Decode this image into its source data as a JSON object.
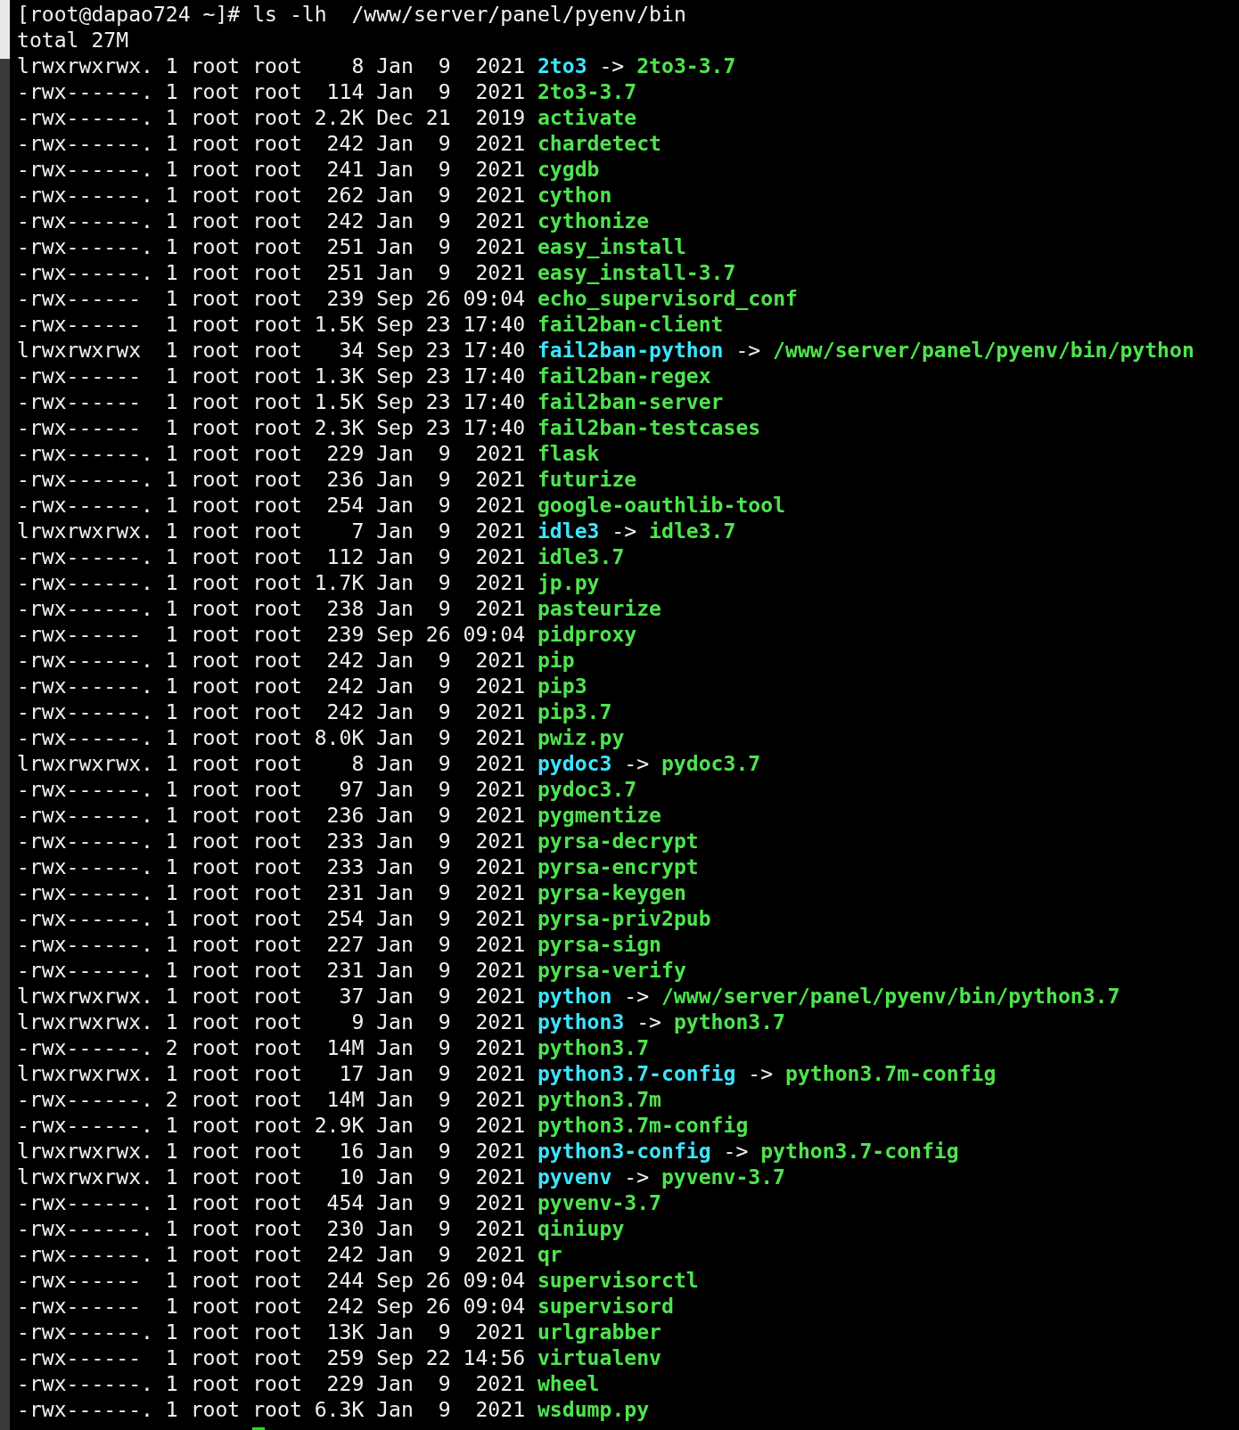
{
  "terminal": {
    "command_line": "[root@dapao724 ~]# ls -lh  /www/server/panel/pyenv/bin",
    "total": "total 27M",
    "cursor": true,
    "rows": [
      {
        "perms": "lrwxrwxrwx.",
        "links": "1",
        "owner": "root",
        "group": "root",
        "size": "8",
        "month": "Jan",
        "day": "9",
        "time": "2021",
        "name": "2to3",
        "kind": "link",
        "arrow": "->",
        "target": "2to3-3.7"
      },
      {
        "perms": "-rwx------.",
        "links": "1",
        "owner": "root",
        "group": "root",
        "size": "114",
        "month": "Jan",
        "day": "9",
        "time": "2021",
        "name": "2to3-3.7",
        "kind": "file"
      },
      {
        "perms": "-rwx------.",
        "links": "1",
        "owner": "root",
        "group": "root",
        "size": "2.2K",
        "month": "Dec",
        "day": "21",
        "time": "2019",
        "name": "activate",
        "kind": "file"
      },
      {
        "perms": "-rwx------.",
        "links": "1",
        "owner": "root",
        "group": "root",
        "size": "242",
        "month": "Jan",
        "day": "9",
        "time": "2021",
        "name": "chardetect",
        "kind": "file"
      },
      {
        "perms": "-rwx------.",
        "links": "1",
        "owner": "root",
        "group": "root",
        "size": "241",
        "month": "Jan",
        "day": "9",
        "time": "2021",
        "name": "cygdb",
        "kind": "file"
      },
      {
        "perms": "-rwx------.",
        "links": "1",
        "owner": "root",
        "group": "root",
        "size": "262",
        "month": "Jan",
        "day": "9",
        "time": "2021",
        "name": "cython",
        "kind": "file"
      },
      {
        "perms": "-rwx------.",
        "links": "1",
        "owner": "root",
        "group": "root",
        "size": "242",
        "month": "Jan",
        "day": "9",
        "time": "2021",
        "name": "cythonize",
        "kind": "file"
      },
      {
        "perms": "-rwx------.",
        "links": "1",
        "owner": "root",
        "group": "root",
        "size": "251",
        "month": "Jan",
        "day": "9",
        "time": "2021",
        "name": "easy_install",
        "kind": "file"
      },
      {
        "perms": "-rwx------.",
        "links": "1",
        "owner": "root",
        "group": "root",
        "size": "251",
        "month": "Jan",
        "day": "9",
        "time": "2021",
        "name": "easy_install-3.7",
        "kind": "file"
      },
      {
        "perms": "-rwx------",
        "links": "1",
        "owner": "root",
        "group": "root",
        "size": "239",
        "month": "Sep",
        "day": "26",
        "time": "09:04",
        "name": "echo_supervisord_conf",
        "kind": "file"
      },
      {
        "perms": "-rwx------",
        "links": "1",
        "owner": "root",
        "group": "root",
        "size": "1.5K",
        "month": "Sep",
        "day": "23",
        "time": "17:40",
        "name": "fail2ban-client",
        "kind": "file"
      },
      {
        "perms": "lrwxrwxrwx",
        "links": "1",
        "owner": "root",
        "group": "root",
        "size": "34",
        "month": "Sep",
        "day": "23",
        "time": "17:40",
        "name": "fail2ban-python",
        "kind": "link",
        "arrow": "->",
        "target": "/www/server/panel/pyenv/bin/python"
      },
      {
        "perms": "-rwx------",
        "links": "1",
        "owner": "root",
        "group": "root",
        "size": "1.3K",
        "month": "Sep",
        "day": "23",
        "time": "17:40",
        "name": "fail2ban-regex",
        "kind": "file"
      },
      {
        "perms": "-rwx------",
        "links": "1",
        "owner": "root",
        "group": "root",
        "size": "1.5K",
        "month": "Sep",
        "day": "23",
        "time": "17:40",
        "name": "fail2ban-server",
        "kind": "file"
      },
      {
        "perms": "-rwx------",
        "links": "1",
        "owner": "root",
        "group": "root",
        "size": "2.3K",
        "month": "Sep",
        "day": "23",
        "time": "17:40",
        "name": "fail2ban-testcases",
        "kind": "file"
      },
      {
        "perms": "-rwx------.",
        "links": "1",
        "owner": "root",
        "group": "root",
        "size": "229",
        "month": "Jan",
        "day": "9",
        "time": "2021",
        "name": "flask",
        "kind": "file"
      },
      {
        "perms": "-rwx------.",
        "links": "1",
        "owner": "root",
        "group": "root",
        "size": "236",
        "month": "Jan",
        "day": "9",
        "time": "2021",
        "name": "futurize",
        "kind": "file"
      },
      {
        "perms": "-rwx------.",
        "links": "1",
        "owner": "root",
        "group": "root",
        "size": "254",
        "month": "Jan",
        "day": "9",
        "time": "2021",
        "name": "google-oauthlib-tool",
        "kind": "file"
      },
      {
        "perms": "lrwxrwxrwx.",
        "links": "1",
        "owner": "root",
        "group": "root",
        "size": "7",
        "month": "Jan",
        "day": "9",
        "time": "2021",
        "name": "idle3",
        "kind": "link",
        "arrow": "->",
        "target": "idle3.7"
      },
      {
        "perms": "-rwx------.",
        "links": "1",
        "owner": "root",
        "group": "root",
        "size": "112",
        "month": "Jan",
        "day": "9",
        "time": "2021",
        "name": "idle3.7",
        "kind": "file"
      },
      {
        "perms": "-rwx------.",
        "links": "1",
        "owner": "root",
        "group": "root",
        "size": "1.7K",
        "month": "Jan",
        "day": "9",
        "time": "2021",
        "name": "jp.py",
        "kind": "file"
      },
      {
        "perms": "-rwx------.",
        "links": "1",
        "owner": "root",
        "group": "root",
        "size": "238",
        "month": "Jan",
        "day": "9",
        "time": "2021",
        "name": "pasteurize",
        "kind": "file"
      },
      {
        "perms": "-rwx------",
        "links": "1",
        "owner": "root",
        "group": "root",
        "size": "239",
        "month": "Sep",
        "day": "26",
        "time": "09:04",
        "name": "pidproxy",
        "kind": "file"
      },
      {
        "perms": "-rwx------.",
        "links": "1",
        "owner": "root",
        "group": "root",
        "size": "242",
        "month": "Jan",
        "day": "9",
        "time": "2021",
        "name": "pip",
        "kind": "file"
      },
      {
        "perms": "-rwx------.",
        "links": "1",
        "owner": "root",
        "group": "root",
        "size": "242",
        "month": "Jan",
        "day": "9",
        "time": "2021",
        "name": "pip3",
        "kind": "file"
      },
      {
        "perms": "-rwx------.",
        "links": "1",
        "owner": "root",
        "group": "root",
        "size": "242",
        "month": "Jan",
        "day": "9",
        "time": "2021",
        "name": "pip3.7",
        "kind": "file"
      },
      {
        "perms": "-rwx------.",
        "links": "1",
        "owner": "root",
        "group": "root",
        "size": "8.0K",
        "month": "Jan",
        "day": "9",
        "time": "2021",
        "name": "pwiz.py",
        "kind": "file"
      },
      {
        "perms": "lrwxrwxrwx.",
        "links": "1",
        "owner": "root",
        "group": "root",
        "size": "8",
        "month": "Jan",
        "day": "9",
        "time": "2021",
        "name": "pydoc3",
        "kind": "link",
        "arrow": "->",
        "target": "pydoc3.7"
      },
      {
        "perms": "-rwx------.",
        "links": "1",
        "owner": "root",
        "group": "root",
        "size": "97",
        "month": "Jan",
        "day": "9",
        "time": "2021",
        "name": "pydoc3.7",
        "kind": "file"
      },
      {
        "perms": "-rwx------.",
        "links": "1",
        "owner": "root",
        "group": "root",
        "size": "236",
        "month": "Jan",
        "day": "9",
        "time": "2021",
        "name": "pygmentize",
        "kind": "file"
      },
      {
        "perms": "-rwx------.",
        "links": "1",
        "owner": "root",
        "group": "root",
        "size": "233",
        "month": "Jan",
        "day": "9",
        "time": "2021",
        "name": "pyrsa-decrypt",
        "kind": "file"
      },
      {
        "perms": "-rwx------.",
        "links": "1",
        "owner": "root",
        "group": "root",
        "size": "233",
        "month": "Jan",
        "day": "9",
        "time": "2021",
        "name": "pyrsa-encrypt",
        "kind": "file"
      },
      {
        "perms": "-rwx------.",
        "links": "1",
        "owner": "root",
        "group": "root",
        "size": "231",
        "month": "Jan",
        "day": "9",
        "time": "2021",
        "name": "pyrsa-keygen",
        "kind": "file"
      },
      {
        "perms": "-rwx------.",
        "links": "1",
        "owner": "root",
        "group": "root",
        "size": "254",
        "month": "Jan",
        "day": "9",
        "time": "2021",
        "name": "pyrsa-priv2pub",
        "kind": "file"
      },
      {
        "perms": "-rwx------.",
        "links": "1",
        "owner": "root",
        "group": "root",
        "size": "227",
        "month": "Jan",
        "day": "9",
        "time": "2021",
        "name": "pyrsa-sign",
        "kind": "file"
      },
      {
        "perms": "-rwx------.",
        "links": "1",
        "owner": "root",
        "group": "root",
        "size": "231",
        "month": "Jan",
        "day": "9",
        "time": "2021",
        "name": "pyrsa-verify",
        "kind": "file"
      },
      {
        "perms": "lrwxrwxrwx.",
        "links": "1",
        "owner": "root",
        "group": "root",
        "size": "37",
        "month": "Jan",
        "day": "9",
        "time": "2021",
        "name": "python",
        "kind": "link",
        "arrow": "->",
        "target": "/www/server/panel/pyenv/bin/python3.7"
      },
      {
        "perms": "lrwxrwxrwx.",
        "links": "1",
        "owner": "root",
        "group": "root",
        "size": "9",
        "month": "Jan",
        "day": "9",
        "time": "2021",
        "name": "python3",
        "kind": "link",
        "arrow": "->",
        "target": "python3.7"
      },
      {
        "perms": "-rwx------.",
        "links": "2",
        "owner": "root",
        "group": "root",
        "size": "14M",
        "month": "Jan",
        "day": "9",
        "time": "2021",
        "name": "python3.7",
        "kind": "file"
      },
      {
        "perms": "lrwxrwxrwx.",
        "links": "1",
        "owner": "root",
        "group": "root",
        "size": "17",
        "month": "Jan",
        "day": "9",
        "time": "2021",
        "name": "python3.7-config",
        "kind": "link",
        "arrow": "->",
        "target": "python3.7m-config"
      },
      {
        "perms": "-rwx------.",
        "links": "2",
        "owner": "root",
        "group": "root",
        "size": "14M",
        "month": "Jan",
        "day": "9",
        "time": "2021",
        "name": "python3.7m",
        "kind": "file"
      },
      {
        "perms": "-rwx------.",
        "links": "1",
        "owner": "root",
        "group": "root",
        "size": "2.9K",
        "month": "Jan",
        "day": "9",
        "time": "2021",
        "name": "python3.7m-config",
        "kind": "file"
      },
      {
        "perms": "lrwxrwxrwx.",
        "links": "1",
        "owner": "root",
        "group": "root",
        "size": "16",
        "month": "Jan",
        "day": "9",
        "time": "2021",
        "name": "python3-config",
        "kind": "link",
        "arrow": "->",
        "target": "python3.7-config"
      },
      {
        "perms": "lrwxrwxrwx.",
        "links": "1",
        "owner": "root",
        "group": "root",
        "size": "10",
        "month": "Jan",
        "day": "9",
        "time": "2021",
        "name": "pyvenv",
        "kind": "link",
        "arrow": "->",
        "target": "pyvenv-3.7"
      },
      {
        "perms": "-rwx------.",
        "links": "1",
        "owner": "root",
        "group": "root",
        "size": "454",
        "month": "Jan",
        "day": "9",
        "time": "2021",
        "name": "pyvenv-3.7",
        "kind": "file"
      },
      {
        "perms": "-rwx------.",
        "links": "1",
        "owner": "root",
        "group": "root",
        "size": "230",
        "month": "Jan",
        "day": "9",
        "time": "2021",
        "name": "qiniupy",
        "kind": "file"
      },
      {
        "perms": "-rwx------.",
        "links": "1",
        "owner": "root",
        "group": "root",
        "size": "242",
        "month": "Jan",
        "day": "9",
        "time": "2021",
        "name": "qr",
        "kind": "file"
      },
      {
        "perms": "-rwx------",
        "links": "1",
        "owner": "root",
        "group": "root",
        "size": "244",
        "month": "Sep",
        "day": "26",
        "time": "09:04",
        "name": "supervisorctl",
        "kind": "file"
      },
      {
        "perms": "-rwx------",
        "links": "1",
        "owner": "root",
        "group": "root",
        "size": "242",
        "month": "Sep",
        "day": "26",
        "time": "09:04",
        "name": "supervisord",
        "kind": "file"
      },
      {
        "perms": "-rwx------.",
        "links": "1",
        "owner": "root",
        "group": "root",
        "size": "13K",
        "month": "Jan",
        "day": "9",
        "time": "2021",
        "name": "urlgrabber",
        "kind": "file"
      },
      {
        "perms": "-rwx------",
        "links": "1",
        "owner": "root",
        "group": "root",
        "size": "259",
        "month": "Sep",
        "day": "22",
        "time": "14:56",
        "name": "virtualenv",
        "kind": "file"
      },
      {
        "perms": "-rwx------.",
        "links": "1",
        "owner": "root",
        "group": "root",
        "size": "229",
        "month": "Jan",
        "day": "9",
        "time": "2021",
        "name": "wheel",
        "kind": "file"
      },
      {
        "perms": "-rwx------.",
        "links": "1",
        "owner": "root",
        "group": "root",
        "size": "6.3K",
        "month": "Jan",
        "day": "9",
        "time": "2021",
        "name": "wsdump.py",
        "kind": "file"
      }
    ]
  }
}
